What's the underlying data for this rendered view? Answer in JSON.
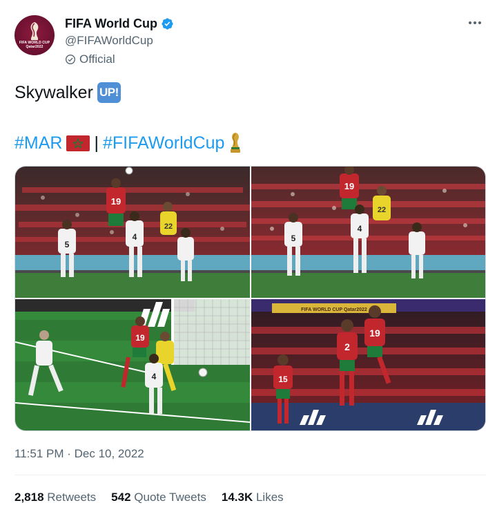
{
  "account": {
    "display_name": "FIFA World Cup",
    "handle": "@FIFAWorldCup",
    "label": "Official",
    "avatar_text_line1": "FIFA WORLD CUP",
    "avatar_text_line2": "Qatar2022"
  },
  "tweet": {
    "text": "Skywalker",
    "emoji_label": "UP!",
    "hashtag_1": "#MAR",
    "separator": "|",
    "hashtag_2": "#FIFAWorldCup"
  },
  "media": {
    "photos": [
      {
        "jersey_a": "19",
        "jersey_b": "22",
        "jersey_c": "5",
        "jersey_d": "4"
      },
      {
        "jersey_a": "19",
        "jersey_b": "22",
        "jersey_c": "5",
        "jersey_d": "4"
      },
      {
        "jersey_a": "19",
        "jersey_b": "4"
      },
      {
        "jersey_a": "2",
        "jersey_b": "19",
        "jersey_c": "15",
        "banner": "FIFA WORLD CUP Qatar2022"
      }
    ]
  },
  "timestamp": "11:51 PM · Dec 10, 2022",
  "stats": {
    "retweets_count": "2,818",
    "retweets_label": "Retweets",
    "quotes_count": "542",
    "quotes_label": "Quote Tweets",
    "likes_count": "14.3K",
    "likes_label": "Likes"
  },
  "colors": {
    "link": "#1d9bf0",
    "secondary_text": "#536471",
    "verified": "#1d9bf0",
    "avatar_bg": "#8d1b3d"
  }
}
